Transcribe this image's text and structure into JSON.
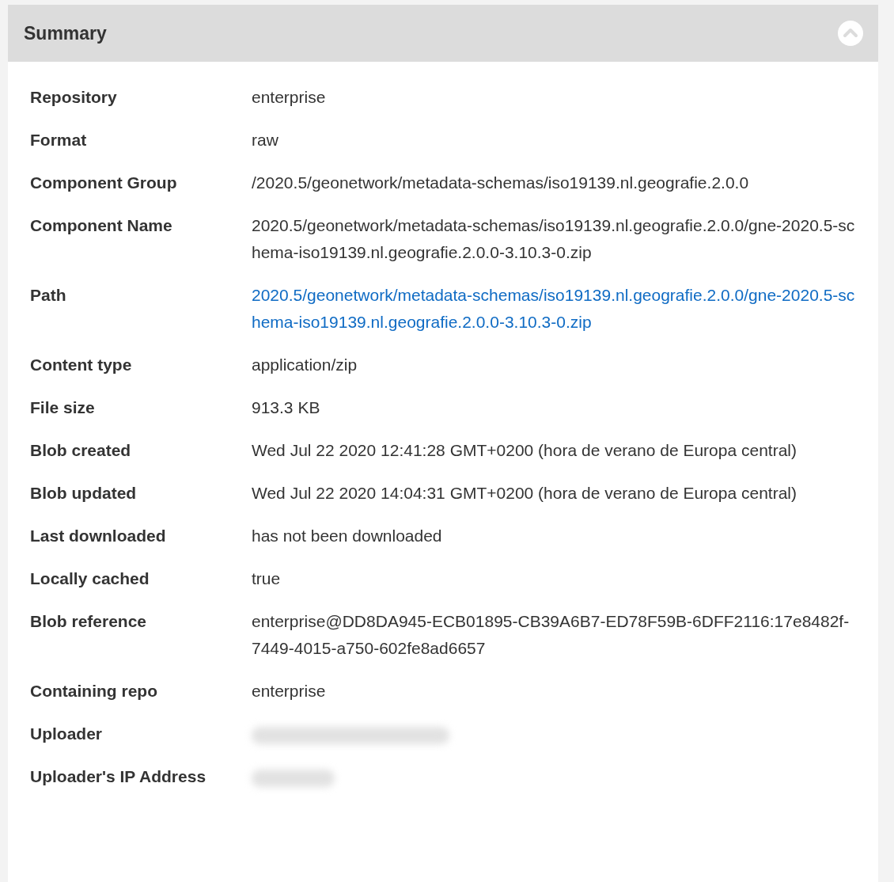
{
  "panel": {
    "title": "Summary",
    "expanded": true
  },
  "rows": [
    {
      "label": "Repository",
      "kind": "text",
      "value": "enterprise"
    },
    {
      "label": "Format",
      "kind": "text",
      "value": "raw"
    },
    {
      "label": "Component Group",
      "kind": "text",
      "value": "/2020.5/geonetwork/metadata-schemas/iso19139.nl.geografie.2.0.0"
    },
    {
      "label": "Component Name",
      "kind": "text",
      "value": "2020.5/geonetwork/metadata-schemas/iso19139.nl.geografie.2.0.0/gne-2020.5-schema-iso19139.nl.geografie.2.0.0-3.10.3-0.zip"
    },
    {
      "label": "Path",
      "kind": "link",
      "value": "2020.5/geonetwork/metadata-schemas/iso19139.nl.geografie.2.0.0/gne-2020.5-schema-iso19139.nl.geografie.2.0.0-3.10.3-0.zip"
    },
    {
      "label": "Content type",
      "kind": "text",
      "value": "application/zip"
    },
    {
      "label": "File size",
      "kind": "text",
      "value": "913.3 KB"
    },
    {
      "label": "Blob created",
      "kind": "text",
      "value": "Wed Jul 22 2020 12:41:28 GMT+0200 (hora de verano de Europa central)"
    },
    {
      "label": "Blob updated",
      "kind": "text",
      "value": "Wed Jul 22 2020 14:04:31 GMT+0200 (hora de verano de Europa central)"
    },
    {
      "label": "Last downloaded",
      "kind": "text",
      "value": "has not been downloaded"
    },
    {
      "label": "Locally cached",
      "kind": "text",
      "value": "true"
    },
    {
      "label": "Blob reference",
      "kind": "text",
      "value": "enterprise@DD8DA945-ECB01895-CB39A6B7-ED78F59B-6DFF2116:17e8482f-7449-4015-a750-602fe8ad6657"
    },
    {
      "label": "Containing repo",
      "kind": "text",
      "value": "enterprise"
    },
    {
      "label": "Uploader",
      "kind": "redacted"
    },
    {
      "label": "Uploader's IP Address",
      "kind": "redacted"
    }
  ]
}
